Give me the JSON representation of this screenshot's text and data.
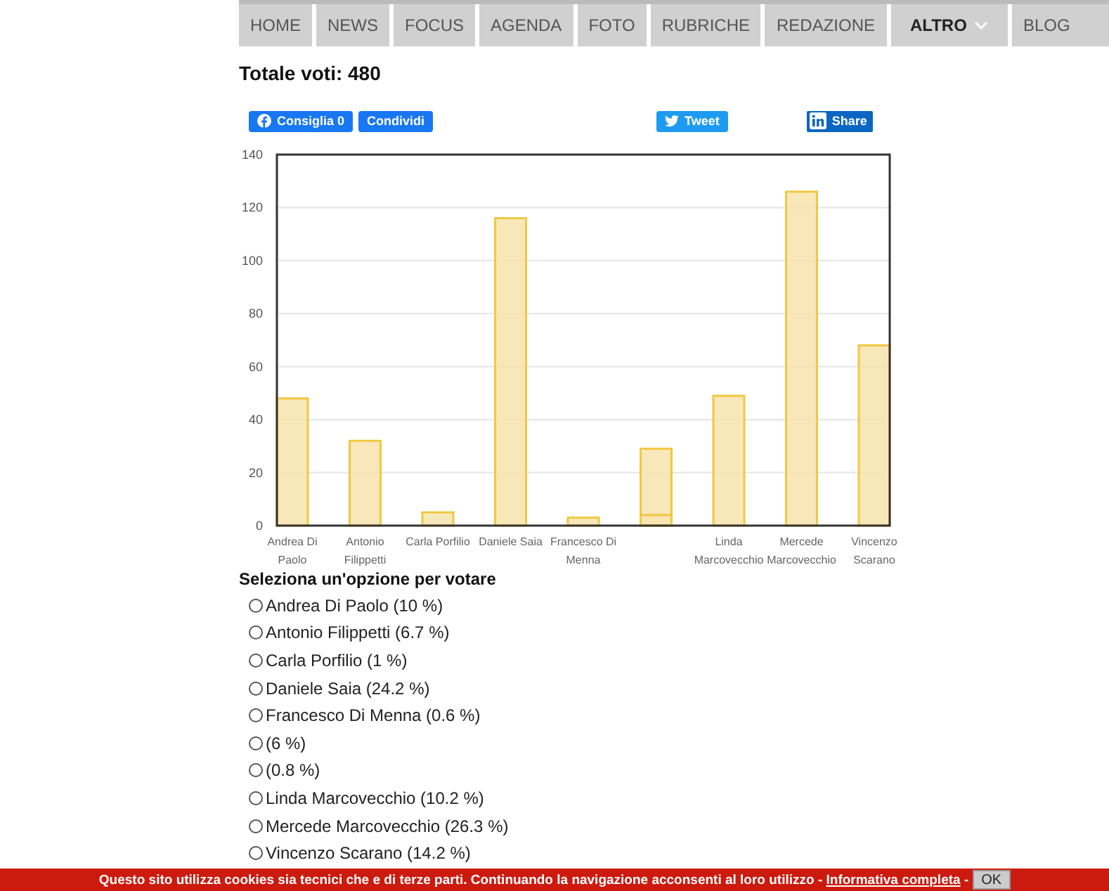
{
  "nav": {
    "items": [
      {
        "label": "HOME",
        "selected": false,
        "dropdown": false
      },
      {
        "label": "NEWS",
        "selected": false,
        "dropdown": false
      },
      {
        "label": "FOCUS",
        "selected": false,
        "dropdown": false
      },
      {
        "label": "AGENDA",
        "selected": false,
        "dropdown": false
      },
      {
        "label": "FOTO",
        "selected": false,
        "dropdown": false
      },
      {
        "label": "RUBRICHE",
        "selected": false,
        "dropdown": false
      },
      {
        "label": "REDAZIONE",
        "selected": false,
        "dropdown": false
      },
      {
        "label": "ALTRO",
        "selected": true,
        "dropdown": true
      },
      {
        "label": "BLOG",
        "selected": false,
        "dropdown": false
      }
    ]
  },
  "total": "Totale voti: 480",
  "social": [
    {
      "kind": "facebook",
      "label": "Consiglia 0"
    },
    {
      "kind": "share",
      "label": "Condividi"
    },
    {
      "kind": "twitter",
      "label": "Tweet"
    },
    {
      "kind": "linkedin",
      "label": "Share"
    }
  ],
  "chart_data": {
    "type": "bar",
    "categories": [
      "Andrea Di Paolo",
      "Antonio Filippetti",
      "Carla Porfilio",
      "Daniele Saia",
      "Francesco Di Menna",
      null,
      null,
      "Linda Marcovecchio",
      "Mercede Marcovecchio",
      "Vincenzo Scarano"
    ],
    "values": [
      48,
      32,
      5,
      116,
      3,
      29,
      4,
      49,
      126,
      68
    ],
    "ylim": [
      0,
      140
    ],
    "grid": true,
    "yticks": [
      0,
      20,
      40,
      60,
      80,
      100,
      120,
      140
    ]
  },
  "poll": {
    "heading": "Seleziona un'opzione per votare",
    "options": [
      {
        "label": "Andrea Di Paolo (10 %)",
        "selected": false
      },
      {
        "label": "Antonio Filippetti (6.7 %)",
        "selected": false
      },
      {
        "label": "Carla Porfilio (1 %)",
        "selected": false
      },
      {
        "label": "Daniele Saia (24.2 %)",
        "selected": false
      },
      {
        "label": "Francesco Di Menna (0.6 %)",
        "selected": false
      },
      {
        "label": "(6 %)",
        "selected": false
      },
      {
        "label": "(0.8 %)",
        "selected": false
      },
      {
        "label": "Linda Marcovecchio (10.2 %)",
        "selected": false
      },
      {
        "label": "Mercede Marcovecchio (26.3 %)",
        "selected": false
      },
      {
        "label": "Vincenzo Scarano (14.2 %)",
        "selected": false
      }
    ]
  },
  "cookie": {
    "text": "Questo sito utilizza cookies sia tecnici che e di terze parti. Continuando la navigazione acconsenti al loro utilizzo - ",
    "link": "Informativa completa",
    "after": " -",
    "button": "OK"
  }
}
